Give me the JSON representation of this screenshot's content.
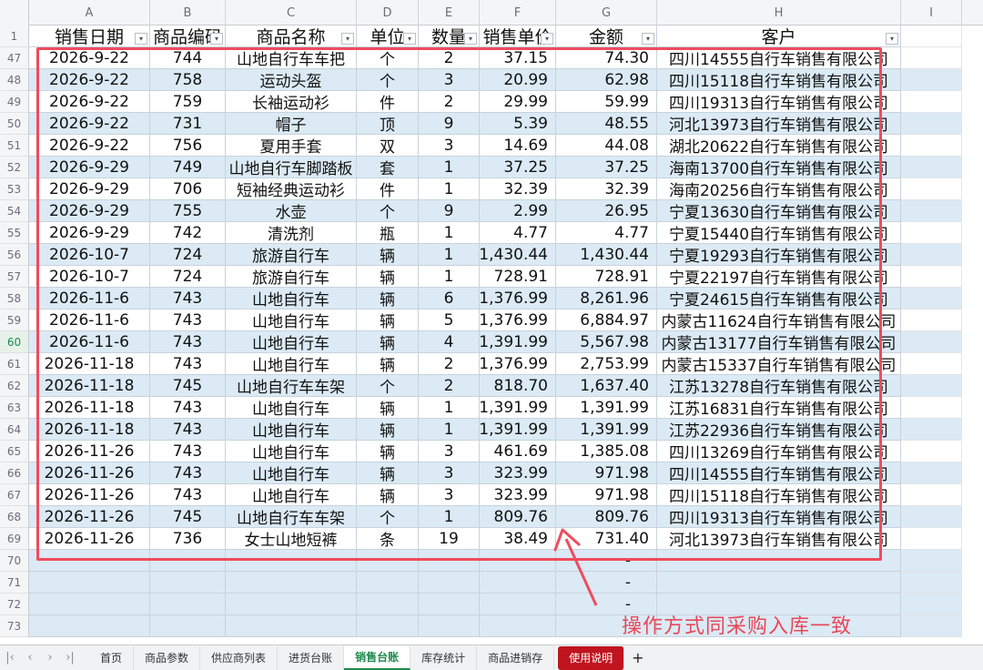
{
  "columns": [
    "A",
    "B",
    "C",
    "D",
    "E",
    "F",
    "G",
    "H",
    "I"
  ],
  "header": {
    "row_number": "1",
    "cells": [
      "销售日期",
      "商品编码",
      "商品名称",
      "单位",
      "数量",
      "销售单价",
      "金额",
      "客户"
    ]
  },
  "rows": [
    {
      "n": "47",
      "cells": [
        "2026-9-22",
        "744",
        "山地自行车车把",
        "个",
        "2",
        "37.15",
        "74.30",
        "四川14555自行车销售有限公司"
      ]
    },
    {
      "n": "48",
      "cells": [
        "2026-9-22",
        "758",
        "运动头盔",
        "个",
        "3",
        "20.99",
        "62.98",
        "四川15118自行车销售有限公司"
      ]
    },
    {
      "n": "49",
      "cells": [
        "2026-9-22",
        "759",
        "长袖运动衫",
        "件",
        "2",
        "29.99",
        "59.99",
        "四川19313自行车销售有限公司"
      ]
    },
    {
      "n": "50",
      "cells": [
        "2026-9-22",
        "731",
        "帽子",
        "顶",
        "9",
        "5.39",
        "48.55",
        "河北13973自行车销售有限公司"
      ]
    },
    {
      "n": "51",
      "cells": [
        "2026-9-22",
        "756",
        "夏用手套",
        "双",
        "3",
        "14.69",
        "44.08",
        "湖北20622自行车销售有限公司"
      ]
    },
    {
      "n": "52",
      "cells": [
        "2026-9-29",
        "749",
        "山地自行车脚踏板",
        "套",
        "1",
        "37.25",
        "37.25",
        "海南13700自行车销售有限公司"
      ]
    },
    {
      "n": "53",
      "cells": [
        "2026-9-29",
        "706",
        "短袖经典运动衫",
        "件",
        "1",
        "32.39",
        "32.39",
        "海南20256自行车销售有限公司"
      ]
    },
    {
      "n": "54",
      "cells": [
        "2026-9-29",
        "755",
        "水壶",
        "个",
        "9",
        "2.99",
        "26.95",
        "宁夏13630自行车销售有限公司"
      ]
    },
    {
      "n": "55",
      "cells": [
        "2026-9-29",
        "742",
        "清洗剂",
        "瓶",
        "1",
        "4.77",
        "4.77",
        "宁夏15440自行车销售有限公司"
      ]
    },
    {
      "n": "56",
      "cells": [
        "2026-10-7",
        "724",
        "旅游自行车",
        "辆",
        "1",
        "1,430.44",
        "1,430.44",
        "宁夏19293自行车销售有限公司"
      ]
    },
    {
      "n": "57",
      "cells": [
        "2026-10-7",
        "724",
        "旅游自行车",
        "辆",
        "1",
        "728.91",
        "728.91",
        "宁夏22197自行车销售有限公司"
      ]
    },
    {
      "n": "58",
      "cells": [
        "2026-11-6",
        "743",
        "山地自行车",
        "辆",
        "6",
        "1,376.99",
        "8,261.96",
        "宁夏24615自行车销售有限公司"
      ]
    },
    {
      "n": "59",
      "cells": [
        "2026-11-6",
        "743",
        "山地自行车",
        "辆",
        "5",
        "1,376.99",
        "6,884.97",
        "内蒙古11624自行车销售有限公司"
      ]
    },
    {
      "n": "60",
      "cells": [
        "2026-11-6",
        "743",
        "山地自行车",
        "辆",
        "4",
        "1,391.99",
        "5,567.98",
        "内蒙古13177自行车销售有限公司"
      ]
    },
    {
      "n": "61",
      "cells": [
        "2026-11-18",
        "743",
        "山地自行车",
        "辆",
        "2",
        "1,376.99",
        "2,753.99",
        "内蒙古15337自行车销售有限公司"
      ]
    },
    {
      "n": "62",
      "cells": [
        "2026-11-18",
        "745",
        "山地自行车车架",
        "个",
        "2",
        "818.70",
        "1,637.40",
        "江苏13278自行车销售有限公司"
      ]
    },
    {
      "n": "63",
      "cells": [
        "2026-11-18",
        "743",
        "山地自行车",
        "辆",
        "1",
        "1,391.99",
        "1,391.99",
        "江苏16831自行车销售有限公司"
      ]
    },
    {
      "n": "64",
      "cells": [
        "2026-11-18",
        "743",
        "山地自行车",
        "辆",
        "1",
        "1,391.99",
        "1,391.99",
        "江苏22936自行车销售有限公司"
      ]
    },
    {
      "n": "65",
      "cells": [
        "2026-11-26",
        "743",
        "山地自行车",
        "辆",
        "3",
        "461.69",
        "1,385.08",
        "四川13269自行车销售有限公司"
      ]
    },
    {
      "n": "66",
      "cells": [
        "2026-11-26",
        "743",
        "山地自行车",
        "辆",
        "3",
        "323.99",
        "971.98",
        "四川14555自行车销售有限公司"
      ]
    },
    {
      "n": "67",
      "cells": [
        "2026-11-26",
        "743",
        "山地自行车",
        "辆",
        "3",
        "323.99",
        "971.98",
        "四川15118自行车销售有限公司"
      ]
    },
    {
      "n": "68",
      "cells": [
        "2026-11-26",
        "745",
        "山地自行车车架",
        "个",
        "1",
        "809.76",
        "809.76",
        "四川19313自行车销售有限公司"
      ]
    },
    {
      "n": "69",
      "cells": [
        "2026-11-26",
        "736",
        "女士山地短裤",
        "条",
        "19",
        "38.49",
        "731.40",
        "河北13973自行车销售有限公司"
      ]
    }
  ],
  "empty_rows": [
    {
      "n": "70",
      "amount": "-"
    },
    {
      "n": "71",
      "amount": "-"
    },
    {
      "n": "72",
      "amount": "-"
    },
    {
      "n": "73",
      "amount": ""
    }
  ],
  "active_row": "60",
  "annotation_text": "操作方式同采购入库一致",
  "tabs": {
    "nav": [
      "|<",
      "<",
      ">",
      ">|"
    ],
    "sheets": [
      {
        "label": "首页",
        "state": "normal"
      },
      {
        "label": "商品参数",
        "state": "normal"
      },
      {
        "label": "供应商列表",
        "state": "normal"
      },
      {
        "label": "进货台账",
        "state": "normal"
      },
      {
        "label": "销售台账",
        "state": "active"
      },
      {
        "label": "库存统计",
        "state": "normal"
      },
      {
        "label": "商品进销存",
        "state": "normal"
      },
      {
        "label": "使用说明",
        "state": "red"
      }
    ],
    "add_label": "+"
  },
  "colors": {
    "band": "#dbeaf4",
    "highlight": "#f04b5e",
    "active_tab": "#1f8a4c",
    "red_tab": "#c0141f"
  }
}
